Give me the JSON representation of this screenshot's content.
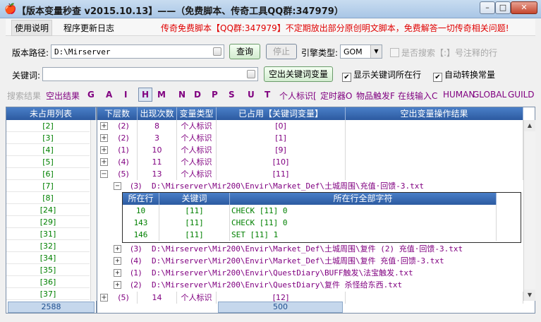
{
  "window": {
    "title": "【版本变量秒查 v2015.10.13】——（免费脚本、传奇工具QQ群:347979）",
    "minimize": "–",
    "maximize": "□",
    "close": "✕"
  },
  "menu": {
    "items": [
      "使用说明",
      "程序更新日志"
    ],
    "notice": "传奇免费脚本【QQ群:347979】不定期放出部分原创明文脚本，免费解答一切传奇相关问题!"
  },
  "toolbar": {
    "path_label": "版本路径:",
    "path_value": "D:\\Mirserver",
    "query_button": "查询",
    "stop_button": "停止",
    "engine_label": "引擎类型:",
    "engine_value": "GOM",
    "search_bracket_label": "是否搜索【:】号注释的行",
    "keyword_label": "关键词:",
    "keyword_value": "",
    "show_keyword_vars_button": "空出关键词变量",
    "show_keyword_line_label": "显示关键词所在行",
    "auto_convert_label": "自动转换常量"
  },
  "tabs": [
    {
      "label": "搜索结果",
      "kind": "hint"
    },
    {
      "label": "空出结果",
      "kind": "text"
    },
    {
      "label": "G",
      "kind": "letter"
    },
    {
      "label": "A",
      "kind": "letter"
    },
    {
      "label": "I",
      "kind": "letter"
    },
    {
      "label": "H",
      "kind": "active"
    },
    {
      "label": "M",
      "kind": "letter"
    },
    {
      "label": "N",
      "kind": "letter"
    },
    {
      "label": "D",
      "kind": "letter"
    },
    {
      "label": "P",
      "kind": "letter"
    },
    {
      "label": "S",
      "kind": "letter"
    },
    {
      "label": "U",
      "kind": "letter"
    },
    {
      "label": "T",
      "kind": "letter"
    },
    {
      "label": "个人标识[",
      "kind": "text"
    },
    {
      "label": "定时器O",
      "kind": "text"
    },
    {
      "label": "物品触发F",
      "kind": "text"
    },
    {
      "label": "在线输入C",
      "kind": "text"
    },
    {
      "label": "HUMAN",
      "kind": "text"
    },
    {
      "label": "GLOBAL",
      "kind": "text"
    },
    {
      "label": "GUILD",
      "kind": "text"
    }
  ],
  "unused_list": {
    "header": "未占用列表",
    "items": [
      "[2]",
      "[3]",
      "[4]",
      "[5]",
      "[6]",
      "[7]",
      "[8]",
      "[24]",
      "[29]",
      "[31]",
      "[32]",
      "[34]",
      "[35]",
      "[36]",
      "[37]"
    ],
    "footer": "2588"
  },
  "results": {
    "headers": [
      "下层数",
      "出现次数",
      "变量类型",
      "已占用【关键词变量】",
      "空出变量操作结果"
    ],
    "rows": [
      {
        "expander": "+",
        "level": "(2)",
        "count": "8",
        "type": "个人标识",
        "var": "[0]"
      },
      {
        "expander": "+",
        "level": "(2)",
        "count": "3",
        "type": "个人标识",
        "var": "[1]"
      },
      {
        "expander": "+",
        "level": "(1)",
        "count": "10",
        "type": "个人标识",
        "var": "[9]"
      },
      {
        "expander": "+",
        "level": "(4)",
        "count": "11",
        "type": "个人标识",
        "var": "[10]"
      },
      {
        "expander": "−",
        "level": "(5)",
        "count": "13",
        "type": "个人标识",
        "var": "[11]"
      }
    ],
    "sub_first": {
      "expander": "−",
      "level": "(3)",
      "path": "D:\\Mirserver\\Mir200\\Envir\\Market_Def\\土城周围\\充值·回馈-3.txt"
    },
    "detail": {
      "headers": [
        "所在行",
        "关键词",
        "所在行全部字符"
      ],
      "rows": [
        {
          "line": "10",
          "keyword": "[11]",
          "text": "CHECK [11] 0"
        },
        {
          "line": "143",
          "keyword": "[11]",
          "text": "CHECK [11] 0"
        },
        {
          "line": "146",
          "keyword": "[11]",
          "text": "SET [11] 1"
        }
      ]
    },
    "sub_rest": [
      {
        "expander": "+",
        "level": "(3)",
        "path": "D:\\Mirserver\\Mir200\\Envir\\Market_Def\\土城周围\\复件 (2) 充值·回馈-3.txt"
      },
      {
        "expander": "+",
        "level": "(4)",
        "path": "D:\\Mirserver\\Mir200\\Envir\\Market_Def\\土城周围\\复件 充值·回馈-3.txt"
      },
      {
        "expander": "+",
        "level": "(1)",
        "path": "D:\\Mirserver\\Mir200\\Envir\\QuestDiary\\BUFF触发\\法宝触发.txt"
      },
      {
        "expander": "+",
        "level": "(2)",
        "path": "D:\\Mirserver\\Mir200\\Envir\\QuestDiary\\复件 杀怪给东西.txt"
      }
    ],
    "last_row": {
      "expander": "+",
      "level": "(5)",
      "count": "14",
      "type": "个人标识",
      "var": "[12]"
    },
    "footer": "500"
  }
}
